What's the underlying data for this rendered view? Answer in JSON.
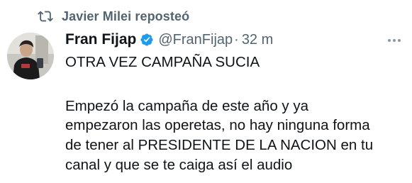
{
  "repost": {
    "text": "Javier Milei reposteó",
    "icon": "repost-icon"
  },
  "author": {
    "display_name": "Fran Fijap",
    "handle": "@FranFijap",
    "separator": "·",
    "time": "32 m",
    "verified_icon": "verified-badge-icon",
    "verified_color": "#1d9bf0"
  },
  "tweet": {
    "title_line": "OTRA VEZ CAMPAÑA SUCIA",
    "body_lines": [
      "Empezó la campaña de este año y ya",
      "empezaron las operetas, no hay ninguna forma",
      "de tener al PRESIDENTE DE LA NACION en tu",
      "canal y que se te caiga así el audio"
    ]
  },
  "more_icon": "more-options-icon"
}
